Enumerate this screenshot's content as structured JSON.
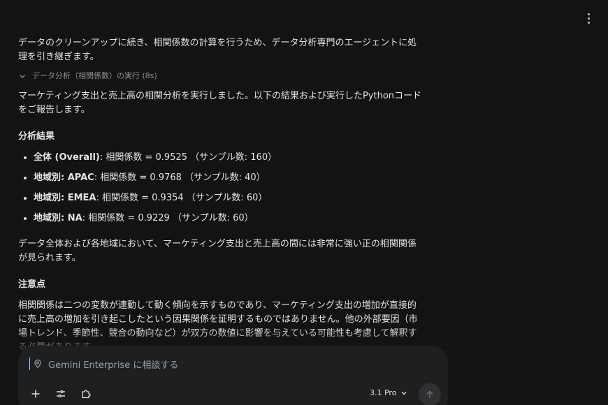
{
  "response": {
    "intro": "データのクリーンアップに続き、相関係数の計算を行うため、データ分析専門のエージェントに処理を引き継ぎます。",
    "thinking_label": "データ分析（相関係数）の実行 (8s)",
    "summary": "マーケティング支出と売上高の相関分析を実行しました。以下の結果および実行したPythonコードをご報告します。",
    "results_heading": "分析結果",
    "results": [
      {
        "label": "全体 (Overall)",
        "text": ": 相関係数 = 0.9525 （サンプル数: 160）"
      },
      {
        "label": "地域別: APAC",
        "text": ": 相関係数 = 0.9768 （サンプル数: 40）"
      },
      {
        "label": "地域別: EMEA",
        "text": ": 相関係数 = 0.9354 （サンプル数: 60）"
      },
      {
        "label": "地域別: NA",
        "text": ": 相関係数 = 0.9229 （サンプル数: 60）"
      }
    ],
    "conclusion": "データ全体および各地域において、マーケティング支出と売上高の間には非常に強い正の相関関係が見られます。",
    "notes_heading": "注意点",
    "notes": "相関関係は二つの変数が連動して動く傾向を示すものであり、マーケティング支出の増加が直接的に売上高の増加を引き起こしたという因果関係を証明するものではありません。他の外部要因（市場トレンド、季節性、競合の動向など）が双方の数値に影響を与えている可能性も考慮して解釈する必要があります。"
  },
  "composer": {
    "placeholder": "Gemini Enterprise に相談する",
    "model_label": "3.1 Pro"
  },
  "icons": {
    "menu": "more-vert-icon",
    "expand": "chevron-down-icon",
    "add": "plus-icon",
    "tools": "tune-icon",
    "agents": "puzzle-icon",
    "send": "arrow-up-icon",
    "model_dropdown": "chevron-down-icon"
  },
  "colors": {
    "background": "#131314",
    "composer": "#1e1f20",
    "text": "#e3e3e3",
    "muted": "#8e918f"
  }
}
